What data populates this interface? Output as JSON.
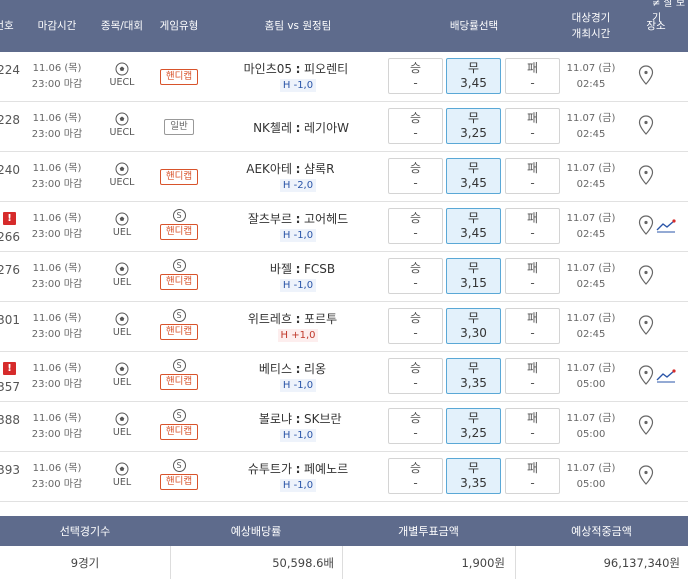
{
  "header": {
    "num": "번호",
    "deadline": "마감시간",
    "sport": "종목/대회",
    "game_type": "게임유형",
    "teams": "홈팀 vs 원정팀",
    "odds": "배당률선택",
    "kickoff_line1": "대상경기",
    "kickoff_line2": "개최시간",
    "venue": "장소",
    "top_note": "≠ 잘 보기"
  },
  "rows": [
    {
      "num": "224",
      "warn": false,
      "date": "11.06 (목)",
      "deadline": "23:00 마감",
      "league": "UECL",
      "s_badge": false,
      "type": "핸디캡",
      "type_plain": false,
      "home": "마인츠05",
      "away": "피오렌티",
      "hcap": "H -1,0",
      "hcap_pos": false,
      "win_label": "승",
      "win_val": "-",
      "draw_label": "무",
      "draw_val": "3,45",
      "lose_label": "패",
      "lose_val": "-",
      "kdate": "11.07 (금)",
      "ktime": "02:45",
      "trend": false
    },
    {
      "num": "228",
      "warn": false,
      "date": "11.06 (목)",
      "deadline": "23:00 마감",
      "league": "UECL",
      "s_badge": false,
      "type": "일반",
      "type_plain": true,
      "home": "NK첼레",
      "away": "레기아W",
      "hcap": "",
      "hcap_pos": false,
      "win_label": "승",
      "win_val": "-",
      "draw_label": "무",
      "draw_val": "3,25",
      "lose_label": "패",
      "lose_val": "-",
      "kdate": "11.07 (금)",
      "ktime": "02:45",
      "trend": false
    },
    {
      "num": "240",
      "warn": false,
      "date": "11.06 (목)",
      "deadline": "23:00 마감",
      "league": "UECL",
      "s_badge": false,
      "type": "핸디캡",
      "type_plain": false,
      "home": "AEK아테",
      "away": "샴록R",
      "hcap": "H -2,0",
      "hcap_pos": false,
      "win_label": "승",
      "win_val": "-",
      "draw_label": "무",
      "draw_val": "3,45",
      "lose_label": "패",
      "lose_val": "-",
      "kdate": "11.07 (금)",
      "ktime": "02:45",
      "trend": false
    },
    {
      "num": "266",
      "warn": true,
      "date": "11.06 (목)",
      "deadline": "23:00 마감",
      "league": "UEL",
      "s_badge": true,
      "type": "핸디캡",
      "type_plain": false,
      "home": "잘츠부르",
      "away": "고어헤드",
      "hcap": "H -1,0",
      "hcap_pos": false,
      "win_label": "승",
      "win_val": "-",
      "draw_label": "무",
      "draw_val": "3,45",
      "lose_label": "패",
      "lose_val": "-",
      "kdate": "11.07 (금)",
      "ktime": "02:45",
      "trend": true
    },
    {
      "num": "276",
      "warn": false,
      "date": "11.06 (목)",
      "deadline": "23:00 마감",
      "league": "UEL",
      "s_badge": true,
      "type": "핸디캡",
      "type_plain": false,
      "home": "바젤",
      "away": "FCSB",
      "hcap": "H -1,0",
      "hcap_pos": false,
      "win_label": "승",
      "win_val": "-",
      "draw_label": "무",
      "draw_val": "3,15",
      "lose_label": "패",
      "lose_val": "-",
      "kdate": "11.07 (금)",
      "ktime": "02:45",
      "trend": false
    },
    {
      "num": "301",
      "warn": false,
      "date": "11.06 (목)",
      "deadline": "23:00 마감",
      "league": "UEL",
      "s_badge": true,
      "type": "핸디캡",
      "type_plain": false,
      "home": "위트레흐",
      "away": "포르투",
      "hcap": "H +1,0",
      "hcap_pos": true,
      "win_label": "승",
      "win_val": "-",
      "draw_label": "무",
      "draw_val": "3,30",
      "lose_label": "패",
      "lose_val": "-",
      "kdate": "11.07 (금)",
      "ktime": "02:45",
      "trend": false
    },
    {
      "num": "357",
      "warn": true,
      "date": "11.06 (목)",
      "deadline": "23:00 마감",
      "league": "UEL",
      "s_badge": true,
      "type": "핸디캡",
      "type_plain": false,
      "home": "베티스",
      "away": "리옹",
      "hcap": "H -1,0",
      "hcap_pos": false,
      "win_label": "승",
      "win_val": "-",
      "draw_label": "무",
      "draw_val": "3,35",
      "lose_label": "패",
      "lose_val": "-",
      "kdate": "11.07 (금)",
      "ktime": "05:00",
      "trend": true
    },
    {
      "num": "388",
      "warn": false,
      "date": "11.06 (목)",
      "deadline": "23:00 마감",
      "league": "UEL",
      "s_badge": true,
      "type": "핸디캡",
      "type_plain": false,
      "home": "볼로냐",
      "away": "SK브란",
      "hcap": "H -1,0",
      "hcap_pos": false,
      "win_label": "승",
      "win_val": "-",
      "draw_label": "무",
      "draw_val": "3,25",
      "lose_label": "패",
      "lose_val": "-",
      "kdate": "11.07 (금)",
      "ktime": "05:00",
      "trend": false
    },
    {
      "num": "393",
      "warn": false,
      "date": "11.06 (목)",
      "deadline": "23:00 마감",
      "league": "UEL",
      "s_badge": true,
      "type": "핸디캡",
      "type_plain": false,
      "home": "슈투트가",
      "away": "페예노르",
      "hcap": "H -1,0",
      "hcap_pos": false,
      "win_label": "승",
      "win_val": "-",
      "draw_label": "무",
      "draw_val": "3,35",
      "lose_label": "패",
      "lose_val": "-",
      "kdate": "11.07 (금)",
      "ktime": "05:00",
      "trend": false
    }
  ],
  "summary": {
    "headers": [
      "선택경기수",
      "예상배당률",
      "개별투표금액",
      "예상적중금액"
    ],
    "values": [
      "9경기",
      "50,598.6배",
      "1,900원",
      "96,137,340원"
    ]
  },
  "colors": {
    "header_bg": "#5e6b8c",
    "selected_bg": "#e3f1fb",
    "selected_border": "#5aa8d6",
    "handicap_red": "#d8532b",
    "warn_red": "#d62b2b"
  }
}
